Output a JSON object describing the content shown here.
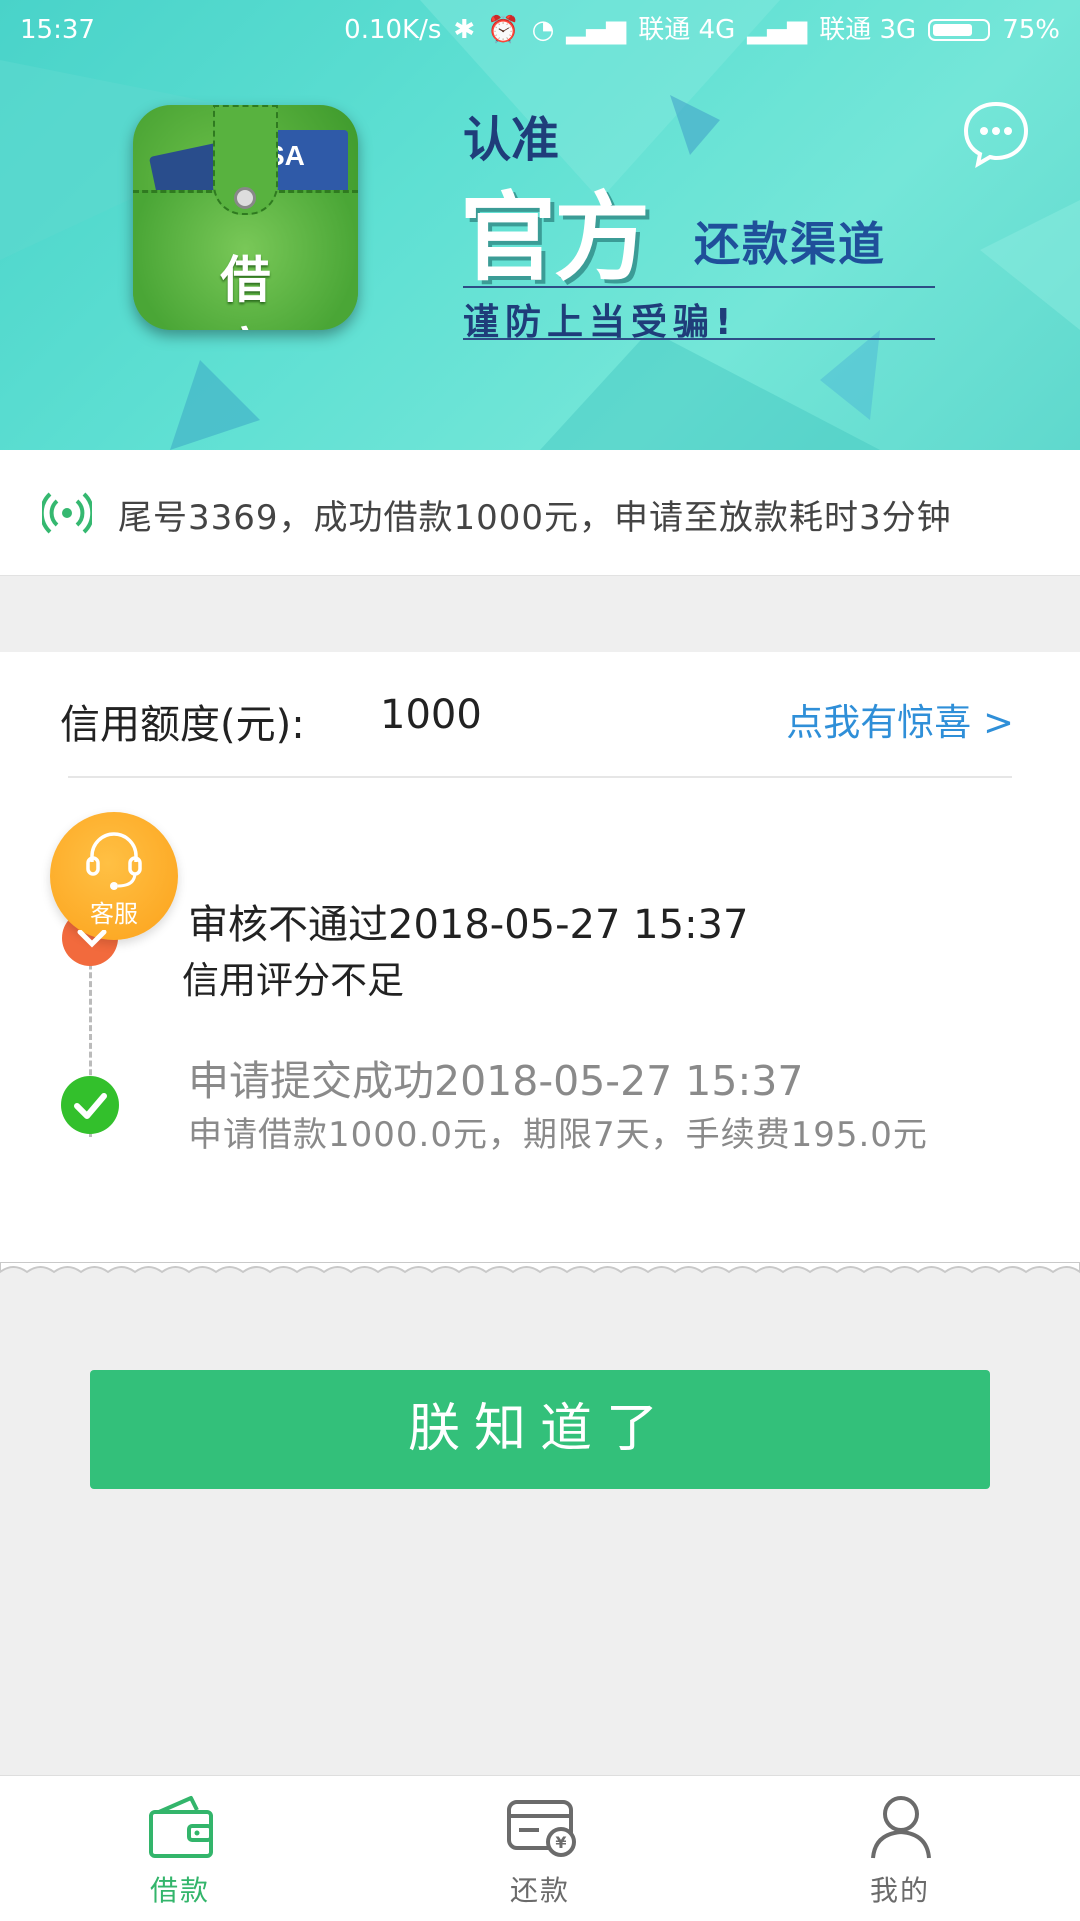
{
  "status_bar": {
    "time": "15:37",
    "speed": "0.10K/s",
    "carrier1": "联通 4G",
    "carrier2": "联通 3G",
    "battery": "75%",
    "battery_level": 0.75
  },
  "banner": {
    "app_icon_label": "借 享",
    "app_icon_card_text": "SA",
    "slogan_line1": "认准",
    "slogan_big": "官方",
    "slogan_small": "还款渠道",
    "slogan_warning": "谨防上当受骗!"
  },
  "notice": {
    "text": "尾号3369，成功借款1000元，申请至放款耗时3分钟"
  },
  "credit": {
    "label": "信用额度(元):",
    "value": "1000",
    "promo_link": "点我有惊喜 >"
  },
  "timeline": [
    {
      "title": "审核不通过2018-05-27 15:37",
      "detail": "信用评分不足",
      "status": "rejected"
    },
    {
      "title": "申请提交成功2018-05-27 15:37",
      "detail": "申请借款1000.0元，期限7天，手续费195.0元",
      "status": "done"
    }
  ],
  "customer_service": {
    "label": "客服"
  },
  "action_button": {
    "label": "朕知道了"
  },
  "tabs": [
    {
      "label": "借款",
      "icon": "wallet-icon",
      "active": true
    },
    {
      "label": "还款",
      "icon": "repay-card-icon",
      "active": false
    },
    {
      "label": "我的",
      "icon": "user-icon",
      "active": false
    }
  ],
  "colors": {
    "accent": "#33c07a",
    "tab_active": "#33b56b",
    "tab_inactive": "#6b6b6b",
    "link": "#2f8fd8",
    "banner": "#5fe0d3"
  }
}
